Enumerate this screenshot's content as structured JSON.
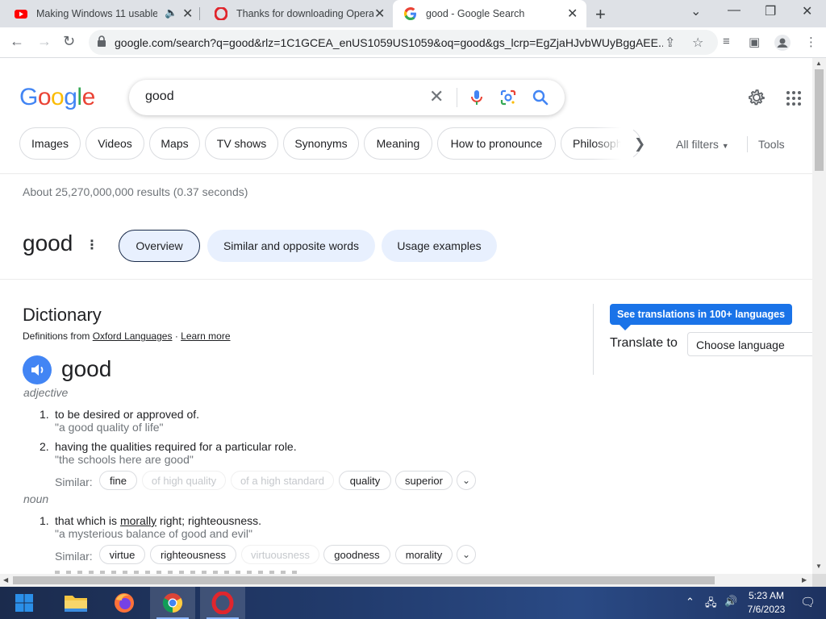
{
  "browser": {
    "tabs": [
      {
        "title": "Making Windows 11 usable",
        "icon": "youtube-icon",
        "active": false
      },
      {
        "title": "Thanks for downloading Opera",
        "icon": "opera-icon",
        "active": false
      },
      {
        "title": "good - Google Search",
        "icon": "google-icon",
        "active": true
      }
    ],
    "url": "google.com/search?q=good&rlz=1C1GCEA_enUS1059US1059&oq=good&gs_lcrp=EgZjaHJvbWUyBggAEE..."
  },
  "google": {
    "logo": "Google",
    "query": "good",
    "chips": [
      "Images",
      "Videos",
      "Maps",
      "TV shows",
      "Synonyms",
      "Meaning",
      "How to pronounce",
      "Philosophy"
    ],
    "all_filters": "All filters",
    "tools": "Tools",
    "stats": "About 25,270,000,000 results (0.37 seconds)"
  },
  "word_panel": {
    "word": "good",
    "tabs": [
      "Overview",
      "Similar and opposite words",
      "Usage examples"
    ]
  },
  "dictionary": {
    "title": "Dictionary",
    "from_prefix": "Definitions from",
    "source": "Oxford Languages",
    "separator": "·",
    "learn_more": "Learn more",
    "headword": "good",
    "adjective": {
      "pos": "adjective",
      "senses": [
        {
          "num": "1.",
          "text": "to be desired or approved of.",
          "example": "\"a good quality of life\""
        },
        {
          "num": "2.",
          "text": "having the qualities required for a particular role.",
          "example": "\"the schools here are good\""
        }
      ],
      "similar_label": "Similar:",
      "similar": [
        "fine",
        "of high quality",
        "of a high standard",
        "quality",
        "superior"
      ]
    },
    "noun": {
      "pos": "noun",
      "senses": [
        {
          "num": "1.",
          "text_before": "that which is ",
          "text_link": "morally",
          "text_after": " right; righteousness.",
          "example": "\"a mysterious balance of good and evil\""
        }
      ],
      "similar_label": "Similar:",
      "similar": [
        "virtue",
        "righteousness",
        "virtuousness",
        "goodness",
        "morality"
      ]
    }
  },
  "translate": {
    "button": "See translations in 100+ languages",
    "label": "Translate to",
    "select": "Choose language"
  },
  "taskbar": {
    "time": "5:23 AM",
    "date": "7/6/2023"
  },
  "colors": {
    "google_blue": "#4285f4",
    "google_red": "#ea4335",
    "google_yellow": "#fbbc05",
    "google_green": "#34a853",
    "button_blue": "#1a73e8"
  }
}
